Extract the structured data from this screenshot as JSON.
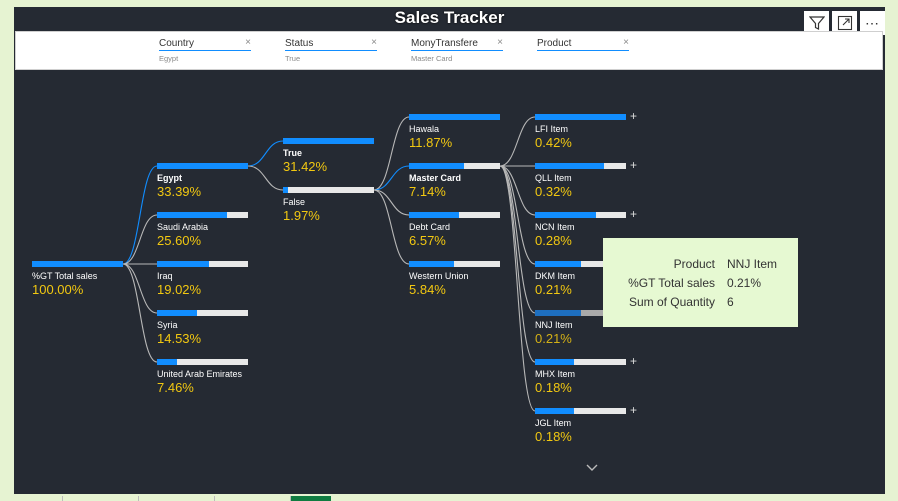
{
  "title": "Sales Tracker",
  "toolbar": {
    "filter_icon": "filter-icon",
    "focus_icon": "focus-mode-icon",
    "more_label": "⋯"
  },
  "slicers": [
    {
      "label": "Country",
      "value": "Egypt"
    },
    {
      "label": "Status",
      "value": "True"
    },
    {
      "label": "MonyTransfere",
      "value": "Master Card"
    },
    {
      "label": "Product",
      "value": ""
    }
  ],
  "clear_glyph": "×",
  "tree": {
    "root": {
      "name": "%GT Total sales",
      "pct": "100.00%",
      "fill": 1.0
    },
    "country": [
      {
        "name": "Egypt",
        "pct": "33.39%",
        "fill": 1.0,
        "active": true
      },
      {
        "name": "Saudi Arabia",
        "pct": "25.60%",
        "fill": 0.77
      },
      {
        "name": "Iraq",
        "pct": "19.02%",
        "fill": 0.57
      },
      {
        "name": "Syria",
        "pct": "14.53%",
        "fill": 0.44
      },
      {
        "name": "United Arab Emirates",
        "pct": "7.46%",
        "fill": 0.22
      }
    ],
    "status": [
      {
        "name": "True",
        "pct": "31.42%",
        "fill": 1.0,
        "active": true
      },
      {
        "name": "False",
        "pct": "1.97%",
        "fill": 0.06
      }
    ],
    "transfer": [
      {
        "name": "Hawala",
        "pct": "11.87%",
        "fill": 1.0
      },
      {
        "name": "Master Card",
        "pct": "7.14%",
        "fill": 0.6,
        "active": true
      },
      {
        "name": "Debt Card",
        "pct": "6.57%",
        "fill": 0.55
      },
      {
        "name": "Western Union",
        "pct": "5.84%",
        "fill": 0.49
      }
    ],
    "product": [
      {
        "name": "LFI Item",
        "pct": "0.42%",
        "fill": 1.0
      },
      {
        "name": "QLL Item",
        "pct": "0.32%",
        "fill": 0.76
      },
      {
        "name": "NCN Item",
        "pct": "0.28%",
        "fill": 0.67
      },
      {
        "name": "DKM Item",
        "pct": "0.21%",
        "fill": 0.5
      },
      {
        "name": "NNJ Item",
        "pct": "0.21%",
        "fill": 0.5,
        "hovered": true
      },
      {
        "name": "MHX Item",
        "pct": "0.18%",
        "fill": 0.43
      },
      {
        "name": "JGL Item",
        "pct": "0.18%",
        "fill": 0.43
      }
    ],
    "expand_glyph": "+"
  },
  "tooltip": {
    "rows": [
      {
        "key": "Product",
        "value": "NNJ Item"
      },
      {
        "key": "%GT Total sales",
        "value": "0.21%"
      },
      {
        "key": "Sum of Quantity",
        "value": "6"
      }
    ]
  },
  "colors": {
    "canvas_bg": "#252a33",
    "page_bg": "#e6f3d2",
    "bar_fill": "#118dff",
    "bar_track": "#e8e8e8",
    "value_text": "#f2c811",
    "tooltip_bg": "#e6f9d2",
    "connector_active": "#118dff",
    "connector": "#b8b8b8"
  },
  "scroll_icon": "chevron-down-icon"
}
